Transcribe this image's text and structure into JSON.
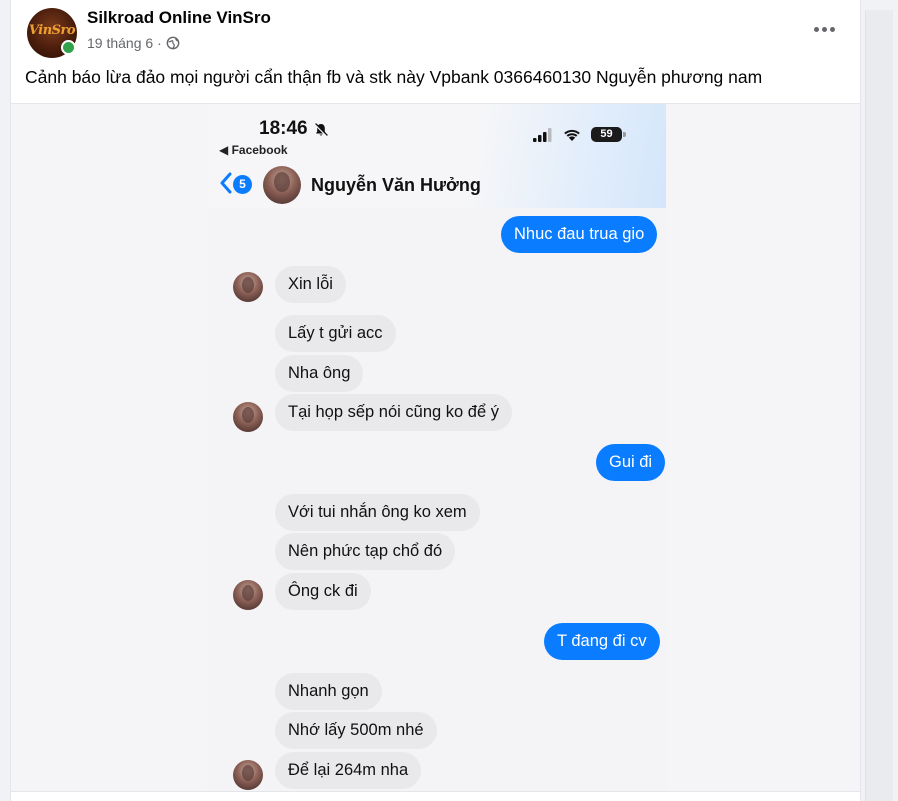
{
  "post": {
    "author_name": "Silkroad Online VinSro",
    "avatar_logo_text": "VinSro",
    "timestamp": "19 tháng 6",
    "meta_separator": "·",
    "text": "Cảnh báo lừa đảo mọi người cẩn thận fb và stk này Vpbank 0366460130 Nguyễn phương nam"
  },
  "screenshot": {
    "status_time": "18:46",
    "back_to_app": "◀ Facebook",
    "battery_level": "59",
    "unread_count": "5",
    "contact_name": "Nguyễn Văn Hưởng",
    "messages": [
      {
        "side": "out",
        "text": "Nhuc đau trua gio"
      },
      {
        "side": "in",
        "text": "Xin lỗi"
      },
      {
        "side": "in",
        "text": "Lấy t gửi acc"
      },
      {
        "side": "in",
        "text": "Nha ông"
      },
      {
        "side": "in",
        "text": "Tại họp sếp nói cũng ko để ý"
      },
      {
        "side": "out",
        "text": "Gui đi"
      },
      {
        "side": "in",
        "text": "Với tui nhắn ông ko xem"
      },
      {
        "side": "in",
        "text": "Nên phức tạp chổ đó"
      },
      {
        "side": "in",
        "text": "Ông ck đi"
      },
      {
        "side": "out",
        "text": "T đang đi cv"
      },
      {
        "side": "in",
        "text": "Nhanh gọn"
      },
      {
        "side": "in",
        "text": "Nhớ lấy 500m nhé"
      },
      {
        "side": "in",
        "text": "Để lại 264m nha"
      }
    ]
  },
  "icons": {
    "globe": "globe-icon",
    "more": "more-options-icon",
    "bell_muted": "bell-slash-icon",
    "signal": "cellular-signal-icon",
    "wifi": "wifi-icon",
    "back": "chevron-left-icon"
  },
  "colors": {
    "messenger_blue": "#0a7cff",
    "incoming_bubble": "#e9e9ec",
    "online_green": "#31a24c",
    "meta_gray": "#65676b"
  }
}
